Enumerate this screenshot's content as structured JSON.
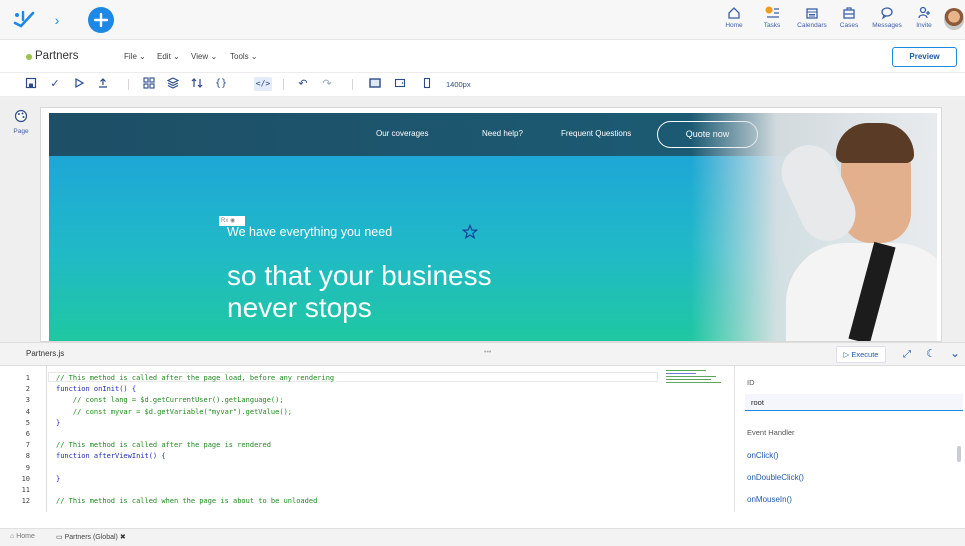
{
  "topbar": {
    "nav": [
      {
        "label": "Home",
        "icon": "home-icon"
      },
      {
        "label": "Tasks",
        "icon": "tasks-icon",
        "badge": ""
      },
      {
        "label": "Calendars",
        "icon": "calendar-icon"
      },
      {
        "label": "Cases",
        "icon": "cases-icon"
      },
      {
        "label": "Messages",
        "icon": "messages-icon"
      },
      {
        "label": "Invite",
        "icon": "invite-icon"
      }
    ]
  },
  "menubar": {
    "page_title": "Partners",
    "menus": [
      "File",
      "Edit",
      "View",
      "Tools"
    ],
    "preview_label": "Preview"
  },
  "toolbar": {
    "width_label": "1400px"
  },
  "side": {
    "page_label": "Page"
  },
  "canvas": {
    "nav_links": [
      "Our coverages",
      "Need help?",
      "Frequent Questions"
    ],
    "cta_label": "Quote now",
    "badge_label": "Rx",
    "tagline": "We have everything you need",
    "headline_1": "so that your business",
    "headline_2": "never stops"
  },
  "editor": {
    "file_name": "Partners.js",
    "dots": "•••",
    "execute_label": "Execute",
    "lines": [
      {
        "n": "1",
        "text": "// This method is called after the page load, before any rendering",
        "cls": "comment"
      },
      {
        "n": "2",
        "text": "function onInit() {",
        "cls": "kw"
      },
      {
        "n": "3",
        "text": "    // const lang = $d.getCurrentUser().getLanguage();",
        "cls": "comment"
      },
      {
        "n": "4",
        "text": "    // const myvar = $d.getVariable(\"myvar\").getValue();",
        "cls": "comment"
      },
      {
        "n": "5",
        "text": "}",
        "cls": "kw"
      },
      {
        "n": "6",
        "text": "",
        "cls": "kw"
      },
      {
        "n": "7",
        "text": "// This method is called after the page is rendered",
        "cls": "comment"
      },
      {
        "n": "8",
        "text": "function afterViewInit() {",
        "cls": "kw"
      },
      {
        "n": "9",
        "text": "",
        "cls": "kw"
      },
      {
        "n": "10",
        "text": "}",
        "cls": "kw"
      },
      {
        "n": "11",
        "text": "",
        "cls": "kw"
      },
      {
        "n": "12",
        "text": "// This method is called when the page is about to be unloaded",
        "cls": "comment"
      }
    ]
  },
  "props": {
    "id_label": "ID",
    "id_value": "root",
    "event_handler_label": "Event Handler",
    "handlers": [
      "onClick()",
      "onDoubleClick()",
      "onMouseIn()"
    ]
  },
  "statusbar": {
    "home_label": "Home",
    "tab_label": "Partners (Global)",
    "close_glyph": "✖"
  },
  "colors": {
    "accent": "#1e88e5",
    "nav_blue": "#3a5fa8",
    "hero_top": "#1a4f66",
    "hero_grad_a": "#1ea7d6",
    "hero_grad_b": "#1fc8a0",
    "title_dot": "#9cc24a"
  }
}
